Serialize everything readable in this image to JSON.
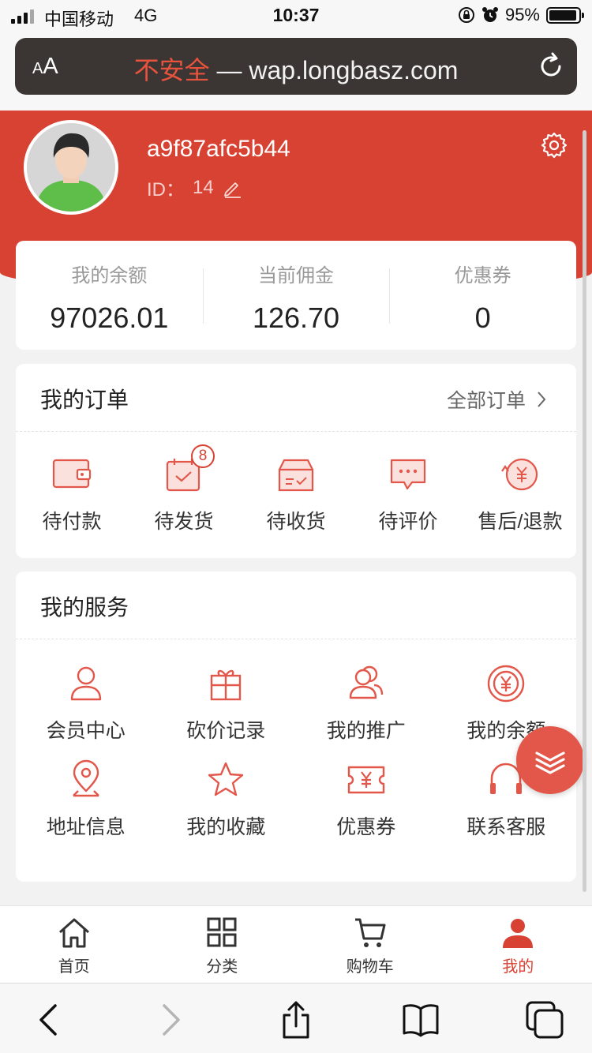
{
  "status_bar": {
    "carrier": "中国移动",
    "network": "4G",
    "time": "10:37",
    "battery": "95%",
    "battery_level": 0.95
  },
  "browser": {
    "text_size_label_small": "A",
    "text_size_label_large": "A",
    "security_label": "不安全",
    "separator": " — ",
    "url": "wap.longbasz.com"
  },
  "profile": {
    "username": "a9f87afc5b44",
    "id_label": "ID：",
    "id_value": "14"
  },
  "balance": [
    {
      "label": "我的余额",
      "value": "97026.01"
    },
    {
      "label": "当前佣金",
      "value": "126.70"
    },
    {
      "label": "优惠券",
      "value": "0"
    }
  ],
  "orders": {
    "title": "我的订单",
    "all_link": "全部订单",
    "items": [
      {
        "label": "待付款",
        "icon": "wallet-icon"
      },
      {
        "label": "待发货",
        "icon": "calendar-check-icon",
        "badge": "8"
      },
      {
        "label": "待收货",
        "icon": "package-icon"
      },
      {
        "label": "待评价",
        "icon": "chat-bubble-icon"
      },
      {
        "label": "售后/退款",
        "icon": "refund-icon"
      }
    ]
  },
  "services": {
    "title": "我的服务",
    "items": [
      {
        "label": "会员中心",
        "icon": "user-icon"
      },
      {
        "label": "砍价记录",
        "icon": "gift-icon"
      },
      {
        "label": "我的推广",
        "icon": "users-icon"
      },
      {
        "label": "我的余额",
        "icon": "yen-coin-icon"
      },
      {
        "label": "地址信息",
        "icon": "location-pin-icon"
      },
      {
        "label": "我的收藏",
        "icon": "star-icon"
      },
      {
        "label": "优惠券",
        "icon": "coupon-icon"
      },
      {
        "label": "联系客服",
        "icon": "headset-icon"
      }
    ]
  },
  "tab_bar": [
    {
      "label": "首页",
      "icon": "home-icon",
      "active": false
    },
    {
      "label": "分类",
      "icon": "grid-icon",
      "active": false
    },
    {
      "label": "购物车",
      "icon": "cart-icon",
      "active": false
    },
    {
      "label": "我的",
      "icon": "user-solid-icon",
      "active": true
    }
  ],
  "colors": {
    "brand_red": "#d84233",
    "icon_red": "#e2574a",
    "url_bar": "#3b3634"
  }
}
